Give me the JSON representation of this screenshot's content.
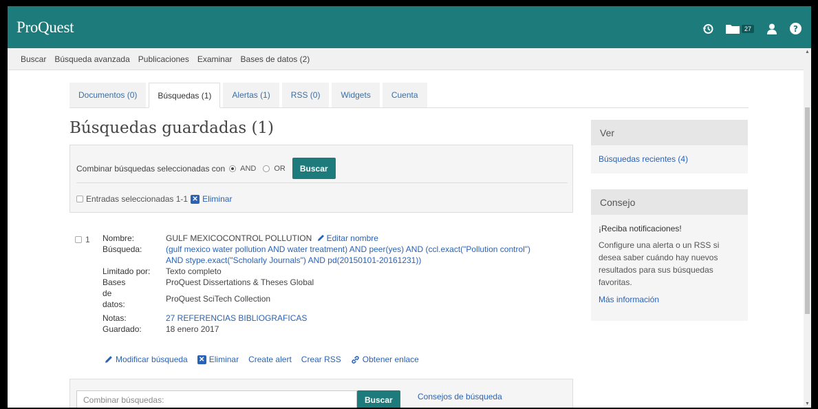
{
  "app": {
    "logo": "ProQuest"
  },
  "header_icons": {
    "history": "history-icon",
    "folder": "folder-icon",
    "folder_count": "27",
    "user": "user-icon",
    "help": "help-icon"
  },
  "nav": {
    "items": [
      {
        "label": "Buscar"
      },
      {
        "label": "Búsqueda avanzada"
      },
      {
        "label": "Publicaciones"
      },
      {
        "label": "Examinar"
      },
      {
        "label": "Bases de datos (2)"
      }
    ]
  },
  "tabs": [
    {
      "label": "Documentos (0)",
      "active": false
    },
    {
      "label": "Búsquedas (1)",
      "active": true
    },
    {
      "label": "Alertas (1)",
      "active": false
    },
    {
      "label": "RSS (0)",
      "active": false
    },
    {
      "label": "Widgets",
      "active": false
    },
    {
      "label": "Cuenta",
      "active": false
    }
  ],
  "page_title": "Búsquedas guardadas (1)",
  "combine": {
    "label": "Combinar búsquedas seleccionadas con",
    "and_label": "AND",
    "or_label": "OR",
    "selected": "AND",
    "button": "Buscar",
    "entries_label": "Entradas seleccionadas 1-1",
    "delete_label": "Eliminar"
  },
  "result": {
    "index": "1",
    "labels": {
      "name": "Nombre:",
      "search": "Búsqueda:",
      "limited": "Limitado por:",
      "databases": "Bases de datos:",
      "notes": "Notas:",
      "saved": "Guardado:"
    },
    "name": "GULF MEXICOCONTROL POLLUTION",
    "edit_name": "Editar nombre",
    "search_line1": "(gulf mexico water pollution AND water treatment) AND peer(yes) AND (ccl.exact(\"Pollution control\")",
    "search_line2": "AND stype.exact(\"Scholarly Journals\") AND pd(20150101-20161231))",
    "limited": "Texto completo",
    "database1": "ProQuest Dissertations & Theses Global",
    "database2": "ProQuest SciTech Collection",
    "notes": "27 REFERENCIAS BIBLIOGRAFICAS",
    "saved": "18 enero 2017",
    "actions": {
      "modify": "Modificar búsqueda",
      "delete": "Eliminar",
      "create_alert": "Create alert",
      "create_rss": "Crear RSS",
      "get_link": "Obtener enlace"
    }
  },
  "sidebar": {
    "view": {
      "title": "Ver",
      "link": "Búsquedas recientes (4)"
    },
    "tip": {
      "title": "Consejo",
      "heading": "¡Reciba notificaciones!",
      "text": "Configure una alerta o un RSS si desea saber cuándo hay nuevos resultados para sus búsquedas favoritas.",
      "link": "Más información"
    }
  },
  "bottom": {
    "placeholder": "Combinar búsquedas:",
    "button": "Buscar",
    "tips": "Consejos de búsqueda"
  },
  "colors": {
    "brand": "#1e7b7b",
    "link": "#2a62b5"
  }
}
